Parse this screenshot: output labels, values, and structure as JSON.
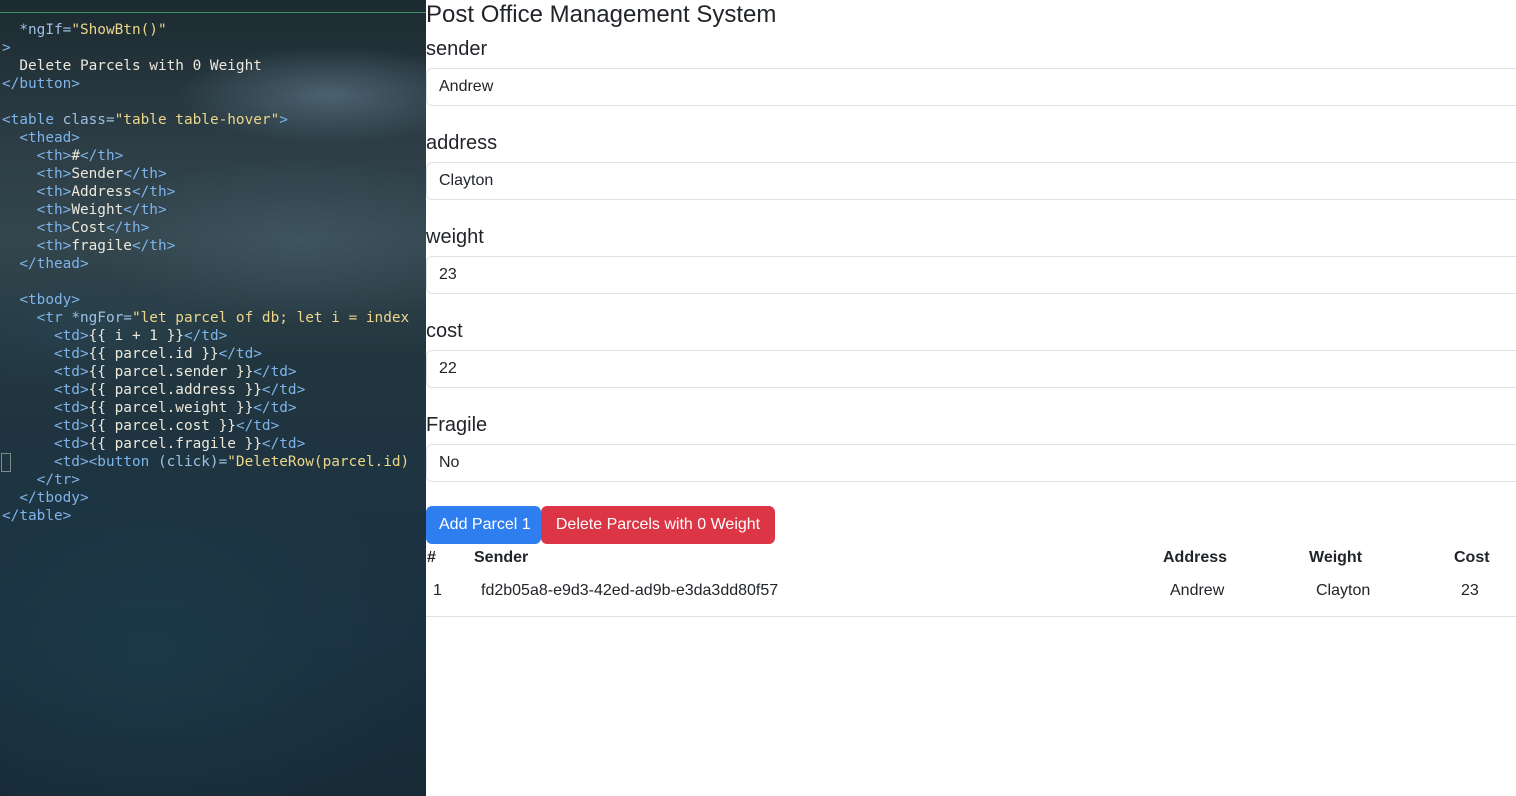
{
  "editor": {
    "lines": [
      [
        {
          "t": "  *ngIf=",
          "c": "attr"
        },
        {
          "t": "\"ShowBtn()\"",
          "c": "str"
        }
      ],
      [
        {
          "t": ">",
          "c": "tag"
        }
      ],
      [
        {
          "t": "  Delete Parcels with 0 Weight",
          "c": "txt"
        }
      ],
      [
        {
          "t": "</button>",
          "c": "tag"
        }
      ],
      [],
      [
        {
          "t": "<table ",
          "c": "tag"
        },
        {
          "t": "class=",
          "c": "attr"
        },
        {
          "t": "\"table table-hover\"",
          "c": "str"
        },
        {
          "t": ">",
          "c": "tag"
        }
      ],
      [
        {
          "t": "  <thead>",
          "c": "tag"
        }
      ],
      [
        {
          "t": "    <th>",
          "c": "tag"
        },
        {
          "t": "#",
          "c": "txt"
        },
        {
          "t": "</th>",
          "c": "tag"
        }
      ],
      [
        {
          "t": "    <th>",
          "c": "tag"
        },
        {
          "t": "Sender",
          "c": "txt"
        },
        {
          "t": "</th>",
          "c": "tag"
        }
      ],
      [
        {
          "t": "    <th>",
          "c": "tag"
        },
        {
          "t": "Address",
          "c": "txt"
        },
        {
          "t": "</th>",
          "c": "tag"
        }
      ],
      [
        {
          "t": "    <th>",
          "c": "tag"
        },
        {
          "t": "Weight",
          "c": "txt"
        },
        {
          "t": "</th>",
          "c": "tag"
        }
      ],
      [
        {
          "t": "    <th>",
          "c": "tag"
        },
        {
          "t": "Cost",
          "c": "txt"
        },
        {
          "t": "</th>",
          "c": "tag"
        }
      ],
      [
        {
          "t": "    <th>",
          "c": "tag"
        },
        {
          "t": "fragile",
          "c": "txt"
        },
        {
          "t": "</th>",
          "c": "tag"
        }
      ],
      [
        {
          "t": "  </thead>",
          "c": "tag"
        }
      ],
      [],
      [
        {
          "t": "  <tbody>",
          "c": "tag"
        }
      ],
      [
        {
          "t": "    <tr ",
          "c": "tag"
        },
        {
          "t": "*ngFor=",
          "c": "attr"
        },
        {
          "t": "\"let parcel of db; let i = index",
          "c": "str"
        }
      ],
      [
        {
          "t": "      <td>",
          "c": "tag"
        },
        {
          "t": "{{ i + 1 }}",
          "c": "txt"
        },
        {
          "t": "</td>",
          "c": "tag"
        }
      ],
      [
        {
          "t": "      <td>",
          "c": "tag"
        },
        {
          "t": "{{ parcel.id }}",
          "c": "txt"
        },
        {
          "t": "</td>",
          "c": "tag"
        }
      ],
      [
        {
          "t": "      <td>",
          "c": "tag"
        },
        {
          "t": "{{ parcel.sender }}",
          "c": "txt"
        },
        {
          "t": "</td>",
          "c": "tag"
        }
      ],
      [
        {
          "t": "      <td>",
          "c": "tag"
        },
        {
          "t": "{{ parcel.address }}",
          "c": "txt"
        },
        {
          "t": "</td>",
          "c": "tag"
        }
      ],
      [
        {
          "t": "      <td>",
          "c": "tag"
        },
        {
          "t": "{{ parcel.weight }}",
          "c": "txt"
        },
        {
          "t": "</td>",
          "c": "tag"
        }
      ],
      [
        {
          "t": "      <td>",
          "c": "tag"
        },
        {
          "t": "{{ parcel.cost }}",
          "c": "txt"
        },
        {
          "t": "</td>",
          "c": "tag"
        }
      ],
      [
        {
          "t": "      <td>",
          "c": "tag"
        },
        {
          "t": "{{ parcel.fragile }}",
          "c": "txt"
        },
        {
          "t": "</td>",
          "c": "tag"
        }
      ],
      [
        {
          "t": "      <td><button ",
          "c": "tag"
        },
        {
          "t": "(click)=",
          "c": "attr"
        },
        {
          "t": "\"DeleteRow(parcel.id)",
          "c": "str"
        }
      ],
      [
        {
          "t": "    </tr>",
          "c": "tag"
        }
      ],
      [
        {
          "t": "  </tbody>",
          "c": "tag"
        }
      ],
      [
        {
          "t": "</table>",
          "c": "tag"
        }
      ]
    ]
  },
  "app": {
    "title": "Post Office Management System",
    "fields": [
      {
        "label": "sender",
        "value": "Andrew"
      },
      {
        "label": "address",
        "value": "Clayton"
      },
      {
        "label": "weight",
        "value": "23"
      },
      {
        "label": "cost",
        "value": "22"
      },
      {
        "label": "Fragile",
        "value": "No"
      }
    ],
    "buttons": {
      "add": "Add Parcel 1",
      "delete": "Delete Parcels with 0 Weight"
    },
    "table": {
      "headers": [
        "#",
        "Sender",
        "Address",
        "Weight",
        "Cost"
      ],
      "rows": [
        [
          "1",
          "fd2b05a8-e9d3-42ed-ad9b-e3da3dd80f57",
          "Andrew",
          "Clayton",
          "23"
        ]
      ]
    }
  },
  "colors": {
    "primary": "#2f7ef0",
    "danger": "#dc3545",
    "text": "#212529",
    "border": "#dee2e6"
  }
}
